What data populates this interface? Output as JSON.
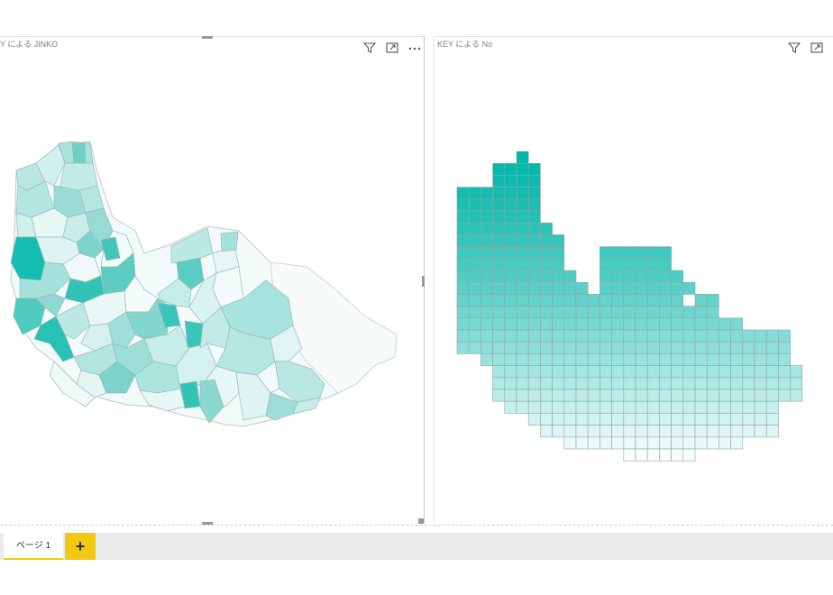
{
  "visuals": {
    "left": {
      "title": "Y による JINKO"
    },
    "right": {
      "title": "KEY による No"
    }
  },
  "icons": {
    "filter": "filter-icon",
    "focus": "focus-mode-icon",
    "more": "more-options-icon"
  },
  "colors": {
    "accent": "#01b8aa",
    "tab_accent": "#f2c811",
    "region_border": "#9ab8b8"
  },
  "pages": {
    "active_tab": "ページ 1",
    "add_label": "+"
  }
}
